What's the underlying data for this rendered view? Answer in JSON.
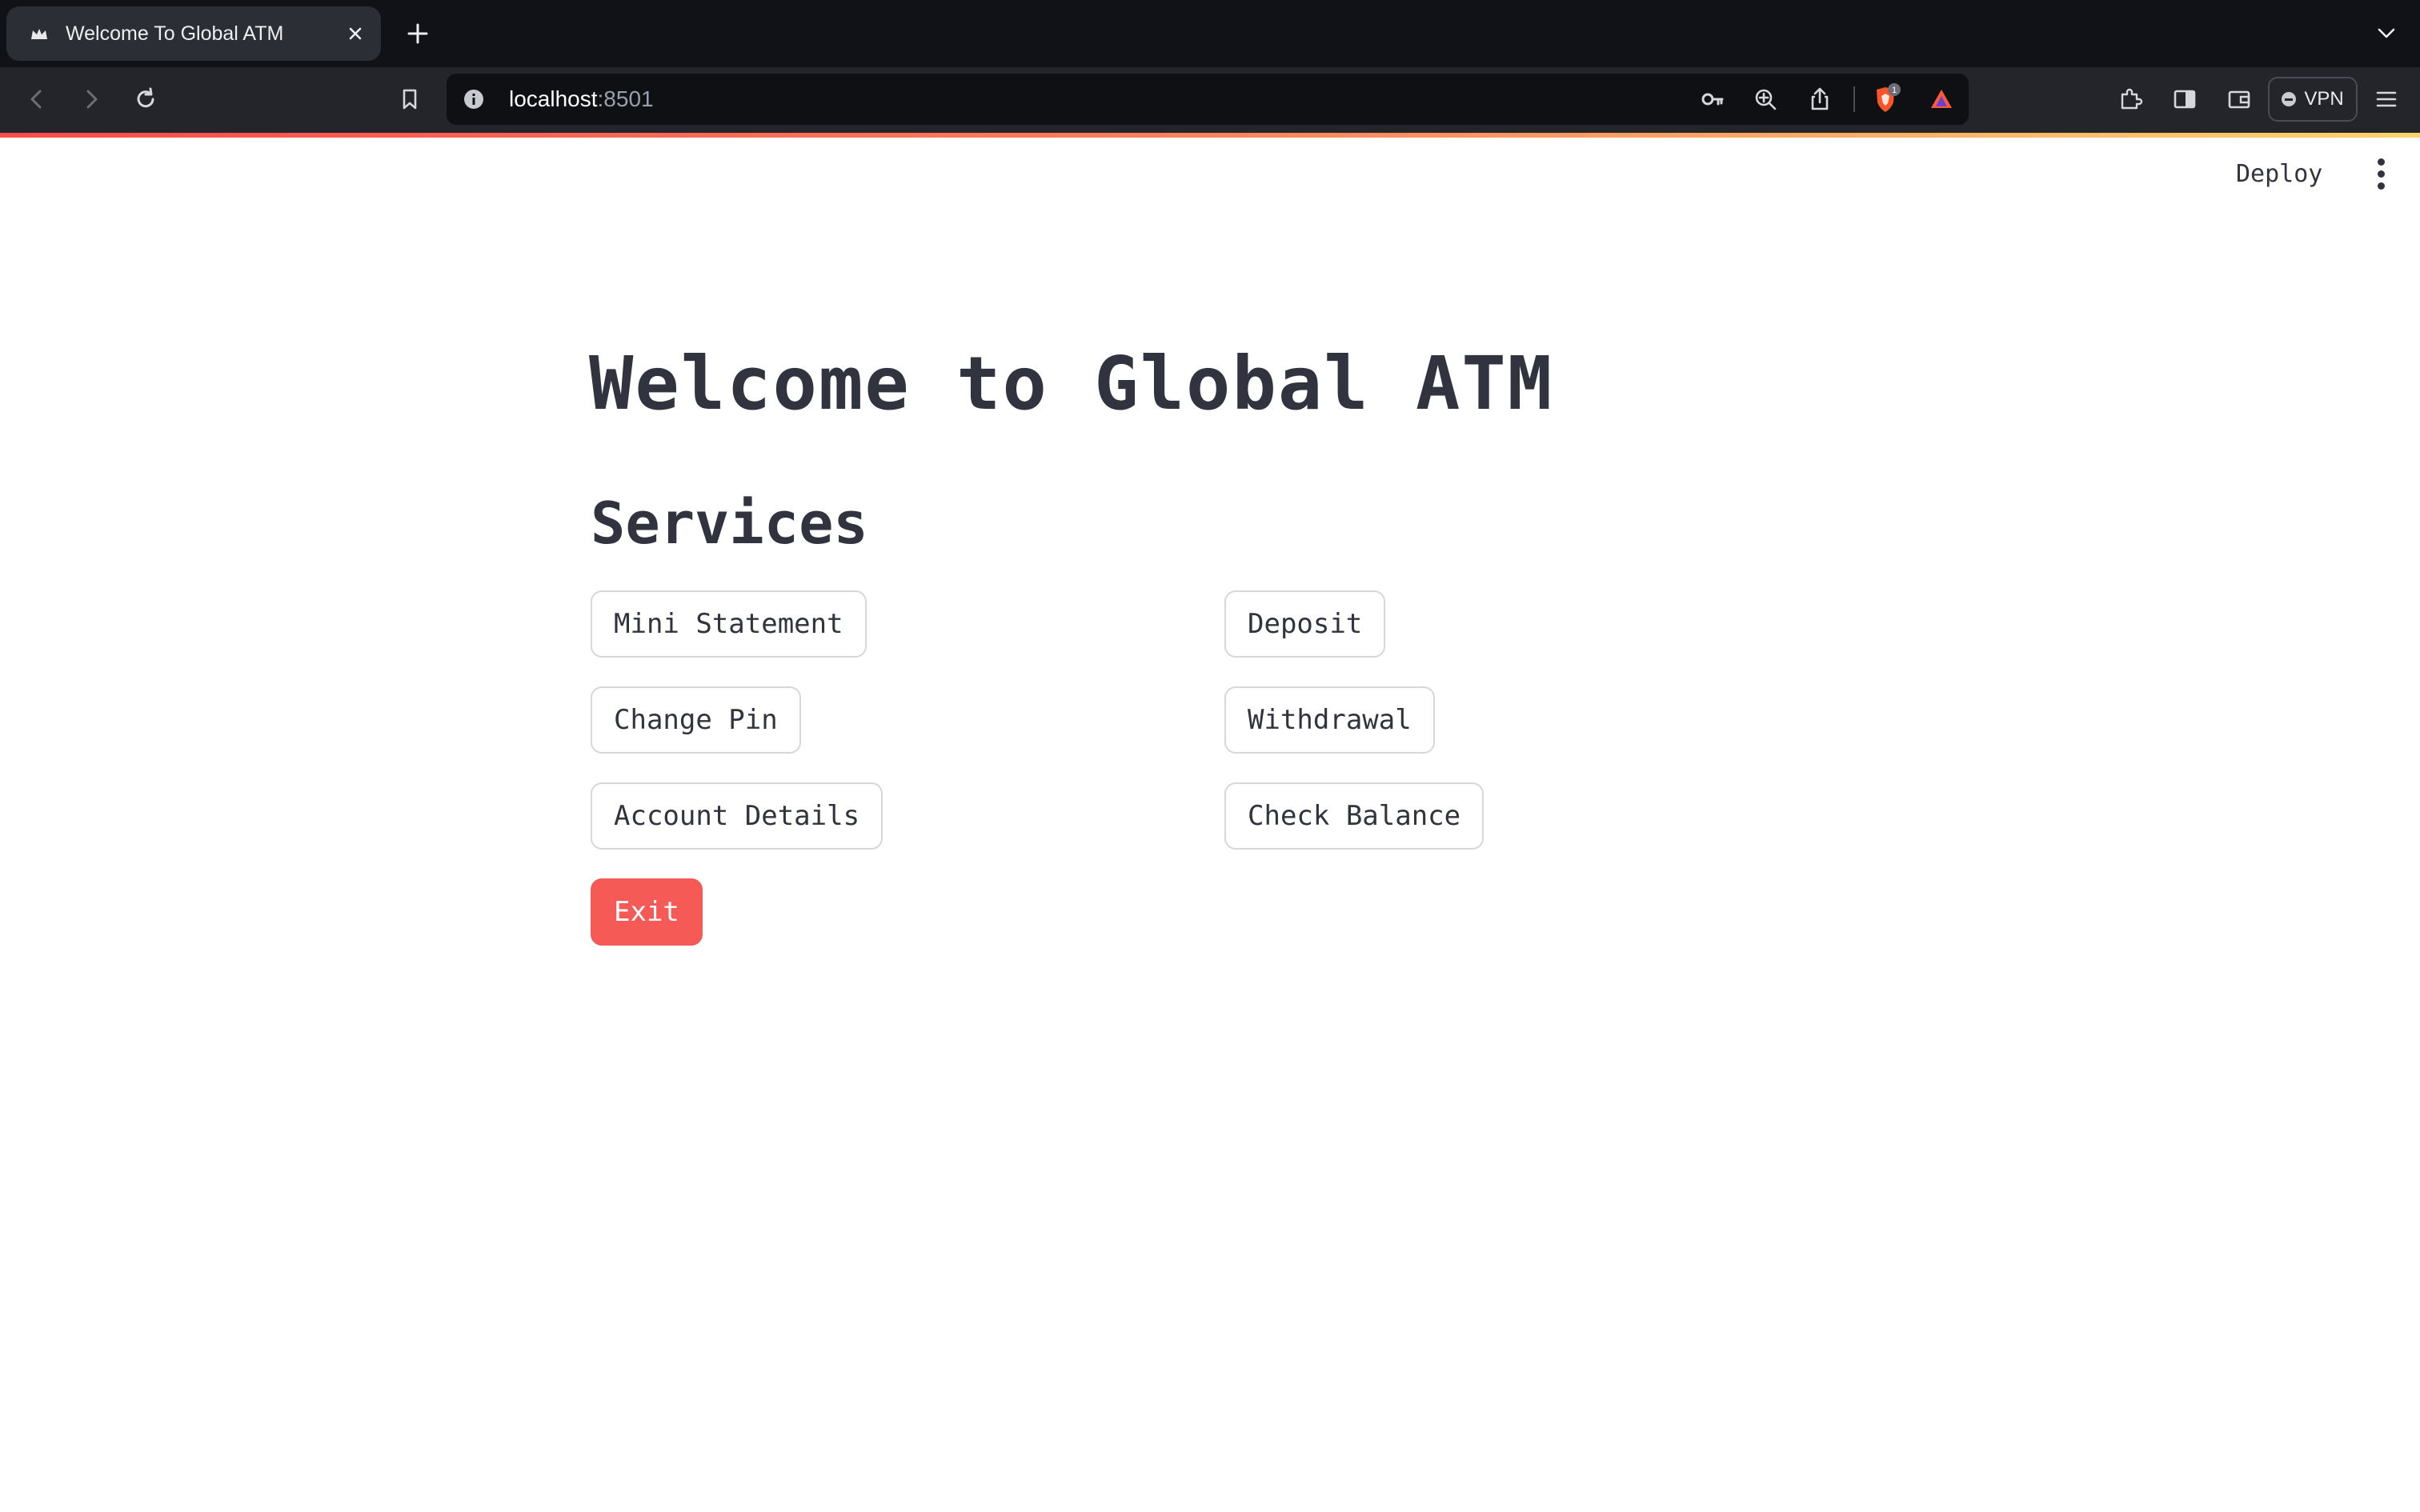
{
  "browser": {
    "tab_title": "Welcome To Global ATM",
    "url_host": "localhost",
    "url_port": ":8501",
    "vpn_label": "VPN",
    "shield_badge": "1"
  },
  "app": {
    "deploy_label": "Deploy",
    "title": "Welcome to Global ATM",
    "subheader": "Services",
    "buttons": {
      "mini_statement": "Mini Statement",
      "deposit": "Deposit",
      "change_pin": "Change Pin",
      "withdrawal": "Withdrawal",
      "account_details": "Account Details",
      "check_balance": "Check Balance",
      "exit": "Exit"
    }
  },
  "colors": {
    "accent": "#ff4b4b",
    "exit_button": "#f55a57",
    "text": "#31333f",
    "chrome_dark": "#101217"
  }
}
